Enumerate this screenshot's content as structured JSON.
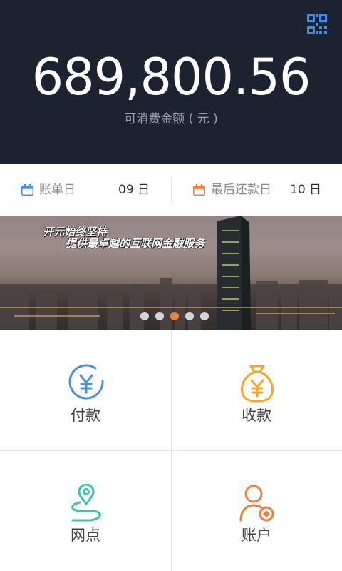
{
  "header": {
    "balance": "689,800.56",
    "balance_label": "可消费金额 ( 元 )",
    "qr_icon": "qr-code-icon",
    "bg_color": "#1c2330"
  },
  "dates": {
    "statement": {
      "label": "账单日",
      "value": "09 日",
      "icon": "calendar-icon",
      "icon_color": "#4a90e2"
    },
    "repayment": {
      "label": "最后还款日",
      "value": "10 日",
      "icon": "calendar-icon",
      "icon_color": "#f07f3c"
    }
  },
  "banner": {
    "slogan_line1": "开元始终坚持",
    "slogan_line2": "提供最卓越的互联网金融服务",
    "slide_count": 5,
    "active_slide": 3,
    "active_dot_color": "#f07f3c"
  },
  "menu": [
    {
      "label": "付款",
      "icon": "yen-circle-icon",
      "color": "#4a90e2"
    },
    {
      "label": "收款",
      "icon": "money-bag-icon",
      "color": "#f5a623"
    },
    {
      "label": "网点",
      "icon": "location-route-icon",
      "color": "#3dc5a0"
    },
    {
      "label": "账户",
      "icon": "user-account-icon",
      "color": "#f07f3c"
    }
  ]
}
